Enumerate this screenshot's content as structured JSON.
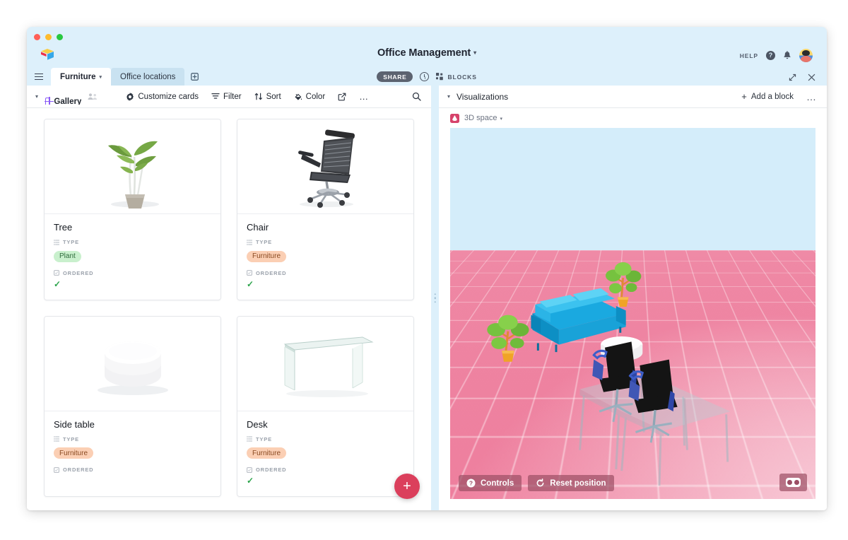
{
  "window": {
    "traffic_lights": [
      "red",
      "yellow",
      "green"
    ],
    "logo": "airtable-logo",
    "title": "Office Management",
    "title_caret": "▾"
  },
  "header": {
    "help_label": "HELP",
    "help_icon": "question-circle-icon",
    "notifications_icon": "bell-icon",
    "avatar": "user-avatar",
    "expand_icon": "expand-icon",
    "close_icon": "close-icon"
  },
  "tabs": {
    "menu_icon": "hamburger-icon",
    "items": [
      {
        "label": "Furniture",
        "active": true,
        "caret": "▾"
      },
      {
        "label": "Office locations",
        "active": false,
        "caret": ""
      }
    ],
    "add_tab_icon": "add-table-icon",
    "share_label": "SHARE",
    "history_icon": "history-clock-icon",
    "blocks_label": "BLOCKS",
    "blocks_icon": "blocks-icon"
  },
  "toolbar": {
    "view_caret": "▾",
    "view_name": "Gallery",
    "view_icon": "gallery-grid-icon",
    "collaborators_icon": "collaborators-icon",
    "items": [
      {
        "label": "Customize cards",
        "icon": "gear-icon"
      },
      {
        "label": "Filter",
        "icon": "filter-icon"
      },
      {
        "label": "Sort",
        "icon": "sort-icon"
      },
      {
        "label": "Color",
        "icon": "color-icon"
      }
    ],
    "share_view_icon": "share-view-icon",
    "more_icon": "ellipsis-icon",
    "search_icon": "search-icon"
  },
  "gallery": {
    "add_record_label": "+",
    "fields": {
      "type_label": "TYPE",
      "ordered_label": "ORDERED"
    },
    "cards": [
      {
        "title": "Tree",
        "image": "potted-plant-image",
        "type": "Plant",
        "type_class": "plant",
        "ordered": true
      },
      {
        "title": "Chair",
        "image": "office-chair-image",
        "type": "Furniture",
        "type_class": "furniture",
        "ordered": true
      },
      {
        "title": "Side table",
        "image": "round-table-image",
        "type": "Furniture",
        "type_class": "furniture",
        "ordered": false
      },
      {
        "title": "Desk",
        "image": "glass-desk-image",
        "type": "Furniture",
        "type_class": "furniture",
        "ordered": true
      }
    ]
  },
  "blocks_panel": {
    "caret": "▾",
    "title": "Visualizations",
    "add_block_label": "Add a block",
    "add_block_plus": "+",
    "more_icon": "ellipsis-icon",
    "block": {
      "icon": "3d-space-block-icon",
      "name": "3D space",
      "caret": "▾"
    },
    "viewport": {
      "controls_label": "Controls",
      "controls_icon": "question-circle-icon",
      "reset_label": "Reset position",
      "reset_icon": "reset-rotate-icon",
      "vr_icon": "vr-goggles-icon",
      "scene": {
        "sky_color": "#d4edfa",
        "floor_color": "#ee7f9e",
        "objects": [
          "sofa",
          "potted-plant",
          "potted-plant",
          "round-side-table",
          "glass-desk",
          "glass-desk",
          "office-chair",
          "office-chair"
        ]
      }
    }
  },
  "colors": {
    "chrome": "#ddf0fb",
    "accent_purple": "#8b5cf6",
    "fab_red": "#db3f5c",
    "badge_plant_bg": "#c9f0cd",
    "badge_furniture_bg": "#fbcfb4",
    "check_green": "#2aa34a"
  }
}
